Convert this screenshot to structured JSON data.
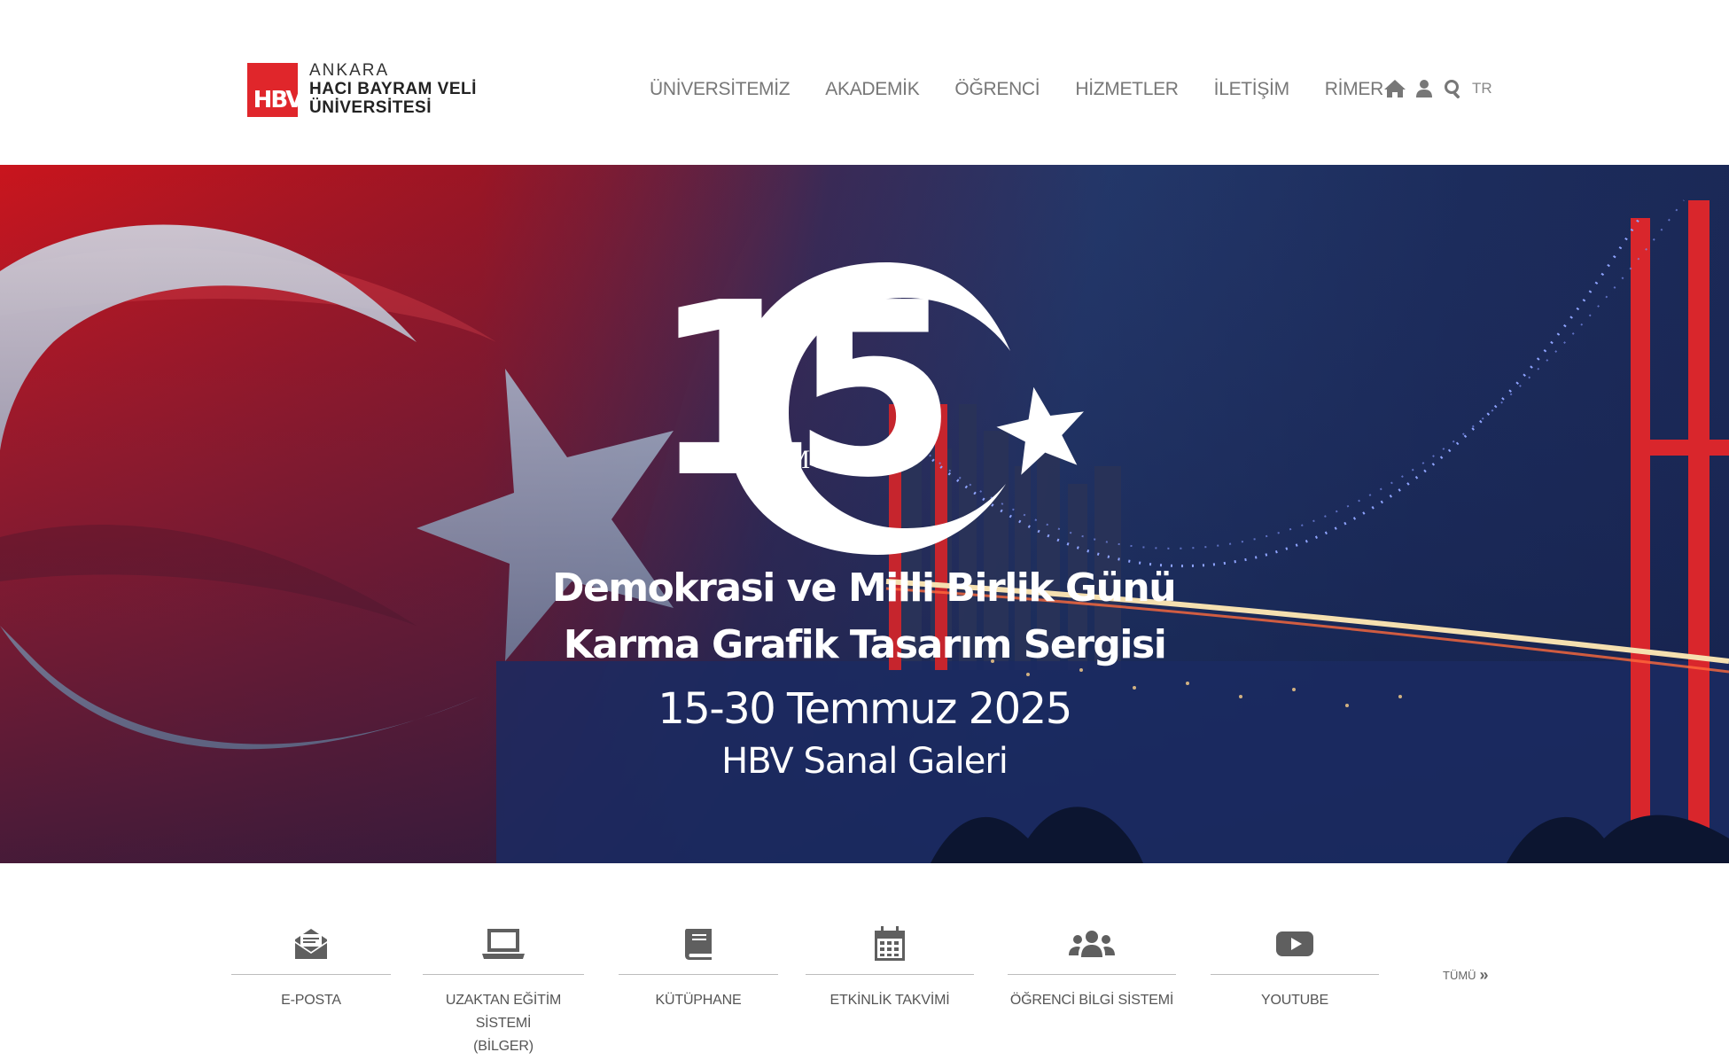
{
  "header": {
    "logo": {
      "mark_text": "HBV",
      "line1": "ANKARA",
      "line2": "HACI BAYRAM VELİ",
      "line3": "ÜNİVERSİTESİ"
    },
    "nav": [
      {
        "label": "ÜNİVERSİTEMİZ"
      },
      {
        "label": "AKADEMİK"
      },
      {
        "label": "ÖĞRENCİ"
      },
      {
        "label": "HİZMETLER"
      },
      {
        "label": "İLETİŞİM"
      },
      {
        "label": "RİMER"
      }
    ],
    "tools": {
      "home_icon": "home-icon",
      "user_icon": "user-icon",
      "search_icon": "search-icon",
      "language": "TR"
    }
  },
  "banner": {
    "number": "15",
    "month": "TEMMUZ",
    "title_line1": "Demokrasi ve Milli Birlik Günü",
    "title_line2": "Karma Grafik Tasarım Sergisi",
    "dates": "15-30 Temmuz 2025",
    "venue": "HBV Sanal Galeri"
  },
  "quick_links": {
    "items": [
      {
        "label": "E-POSTA",
        "icon": "envelope-icon"
      },
      {
        "label_line1": "UZAKTAN EĞİTİM SİSTEMİ",
        "label_line2": "(BİLGER)",
        "icon": "laptop-icon"
      },
      {
        "label": "KÜTÜPHANE",
        "icon": "book-icon"
      },
      {
        "label": "ETKİNLİK TAKVİMİ",
        "icon": "calendar-icon"
      },
      {
        "label": "ÖĞRENCİ BİLGİ SİSTEMİ",
        "icon": "users-icon"
      },
      {
        "label": "YOUTUBE",
        "icon": "youtube-icon"
      }
    ],
    "all_label": "TÜMÜ"
  },
  "colors": {
    "brand_red": "#e0262b",
    "nav_text": "#777777",
    "icon_gray": "#5f5f5f"
  }
}
